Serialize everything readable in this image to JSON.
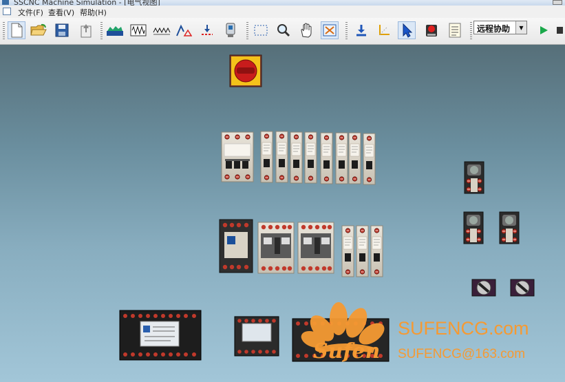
{
  "window": {
    "title": "SSCNC Machine Simulation - [电气视图]"
  },
  "menu": [
    {
      "label": "文件(F)"
    },
    {
      "label": "查看(V)"
    },
    {
      "label": "帮助(H)"
    }
  ],
  "toolbar": {
    "buttons": [
      "new-file",
      "open-folder",
      "save",
      "export",
      "machine-view",
      "resistor-view",
      "coil-view",
      "measure",
      "probe",
      "device",
      "select-rect",
      "zoom",
      "pan",
      "fit-view",
      "download",
      "axis",
      "pointer",
      "record",
      "list"
    ],
    "remote_assist": "远程协助",
    "play": "play",
    "stop": "stop"
  },
  "canvas": {
    "components": [
      "main-power-switch",
      "circuit-breaker-3p",
      "circuit-breaker-1p-1",
      "circuit-breaker-1p-2",
      "circuit-breaker-1p-3",
      "circuit-breaker-1p-4",
      "circuit-breaker-1p-5",
      "circuit-breaker-1p-6",
      "circuit-breaker-1p-7",
      "contactor-1",
      "contactor-2",
      "contactor-3",
      "fuse-1",
      "fuse-2",
      "fuse-3",
      "push-button-1",
      "push-button-2",
      "push-button-3",
      "selector-switch-1",
      "selector-switch-2",
      "transformer",
      "relay-module",
      "terminal-block"
    ]
  },
  "watermark": {
    "logo_text": "Sufen",
    "site": "SUFENCG.com",
    "email": "SUFENCG@163.com",
    "color": "#f59a33"
  }
}
